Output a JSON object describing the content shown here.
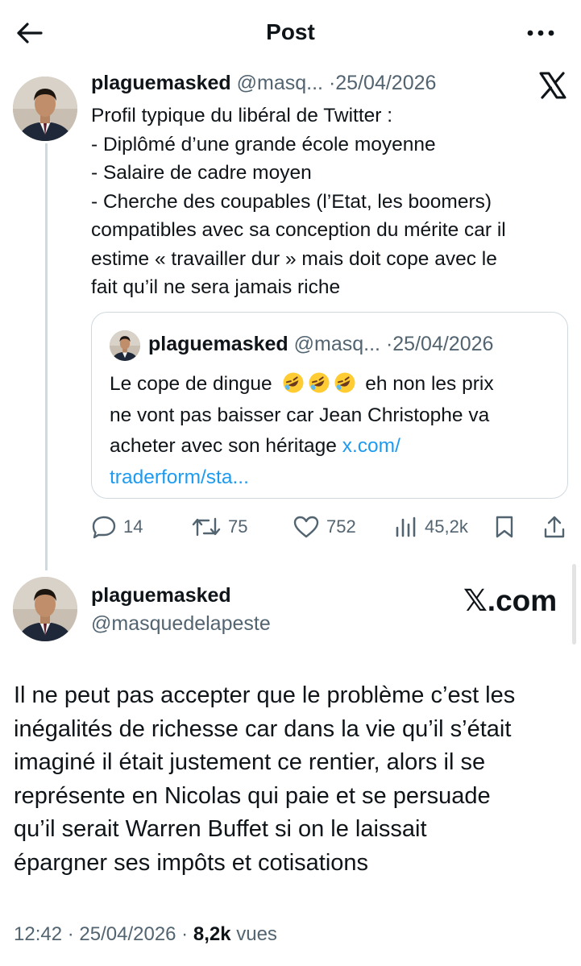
{
  "header": {
    "title": "Post",
    "back_icon": "arrow-left-icon",
    "more_icon": "more-horizontal-icon"
  },
  "tweet": {
    "author_name": "plaguemasked",
    "handle": "@masq...",
    "separator": "·",
    "date": "25/04/2026",
    "source_icon": "x-logo-icon",
    "lines": [
      "Profil typique du libéral de Twitter  :",
      "- Diplômé d’une grande école moyenne",
      "- Salaire de cadre moyen",
      "- Cherche des coupables (l’Etat, les boomers)",
      "compatibles avec sa conception du mérite car il",
      "estime « travailler dur » mais doit cope avec le",
      "fait qu’il ne sera jamais riche"
    ],
    "quote": {
      "author_name": "plaguemasked",
      "handle": "@masq...",
      "separator": "·",
      "date": "25/04/2026",
      "line1": "Le cope de dingue",
      "emoji_name": "rolling-on-floor-laughing-emoji",
      "line1_end": " eh non les prix",
      "line2": "ne vont pas baisser car Jean Christophe va",
      "line3": "acheter avec son héritage ",
      "link1": "x.com/",
      "link2": "traderform/sta..."
    },
    "stats": {
      "replies": "14",
      "reposts": "75",
      "likes": "752",
      "views": "45,2k"
    }
  },
  "profile_card": {
    "name": "plaguemasked",
    "handle": "@masquedelapeste",
    "site": "𝕏.com"
  },
  "main": {
    "lines": [
      "Il ne peut pas accepter que le problème c’est les",
      "inégalités de richesse car dans la vie qu’il s’était",
      "imaginé il était justement ce rentier, alors il se",
      "représente en Nicolas qui paie et se persuade",
      "qu’il serait Warren Buffet si on le laissait",
      "épargner ses impôts et cotisations"
    ]
  },
  "footer": {
    "time": "12:42",
    "separator": " · ",
    "date": "25/04/2026",
    "views_count": "8,2k",
    "views_label": " vues"
  },
  "colors": {
    "text": "#0f1419",
    "secondary": "#536471",
    "link": "#1d9bf0",
    "border": "#cfd9de"
  }
}
